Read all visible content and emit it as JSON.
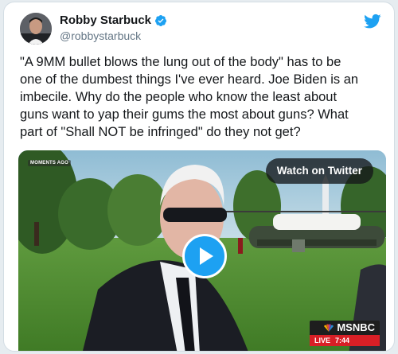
{
  "tweet": {
    "display_name": "Robby Starbuck",
    "handle": "@robbystarbuck",
    "text": "\"A 9MM bullet blows the lung out of the body\" has to be\none of the dumbest things I've ever heard. Joe Biden is an\nimbecile. Why do the people who know the least about\nguns want to yap their gums the most about guns? What\npart of \"Shall NOT be infringed\" do they not get?",
    "verified_icon": "verified-badge-icon",
    "brand_icon": "twitter-bird-icon"
  },
  "media": {
    "watch_label": "Watch on Twitter",
    "corner_bug": "MOMENTS AGO",
    "network": "MSNBC",
    "live_label": "LIVE",
    "live_time": "7:44"
  },
  "colors": {
    "brand": "#1da1f2",
    "live_red": "#d81f26"
  }
}
